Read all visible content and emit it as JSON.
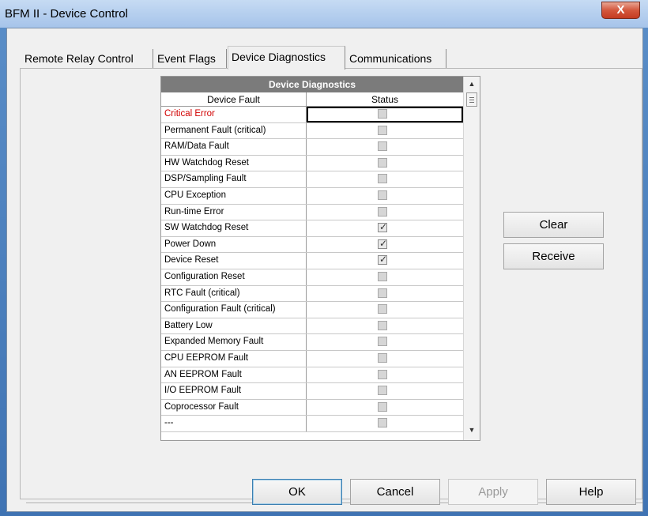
{
  "window": {
    "title": "BFM II - Device Control",
    "close_label": "X"
  },
  "tabs": [
    {
      "label": "Remote Relay Control"
    },
    {
      "label": "Event Flags"
    },
    {
      "label": "Device Diagnostics"
    },
    {
      "label": "Communications"
    }
  ],
  "active_tab": "Device Diagnostics",
  "grid": {
    "title": "Device Diagnostics",
    "columns": [
      "Device Fault",
      "Status"
    ],
    "rows": [
      {
        "fault": "Critical Error",
        "checked": false,
        "critical": true
      },
      {
        "fault": "Permanent Fault (critical)",
        "checked": false
      },
      {
        "fault": "RAM/Data Fault",
        "checked": false
      },
      {
        "fault": "HW Watchdog Reset",
        "checked": false
      },
      {
        "fault": "DSP/Sampling Fault",
        "checked": false
      },
      {
        "fault": "CPU Exception",
        "checked": false
      },
      {
        "fault": "Run-time Error",
        "checked": false
      },
      {
        "fault": "SW Watchdog Reset",
        "checked": true
      },
      {
        "fault": "Power Down",
        "checked": true
      },
      {
        "fault": "Device Reset",
        "checked": true
      },
      {
        "fault": "Configuration Reset",
        "checked": false
      },
      {
        "fault": "RTC Fault (critical)",
        "checked": false
      },
      {
        "fault": "Configuration Fault (critical)",
        "checked": false
      },
      {
        "fault": "Battery Low",
        "checked": false
      },
      {
        "fault": "Expanded Memory Fault",
        "checked": false
      },
      {
        "fault": "CPU EEPROM Fault",
        "checked": false
      },
      {
        "fault": "AN EEPROM Fault",
        "checked": false
      },
      {
        "fault": "I/O EEPROM Fault",
        "checked": false
      },
      {
        "fault": "Coprocessor Fault",
        "checked": false
      },
      {
        "fault": "---",
        "checked": false
      }
    ]
  },
  "side_buttons": {
    "clear": "Clear",
    "receive": "Receive"
  },
  "footer_buttons": {
    "ok": "OK",
    "cancel": "Cancel",
    "apply": "Apply",
    "help": "Help"
  },
  "colors": {
    "critical_text": "#d10000",
    "grid_title_bg": "#7b7b7b"
  }
}
